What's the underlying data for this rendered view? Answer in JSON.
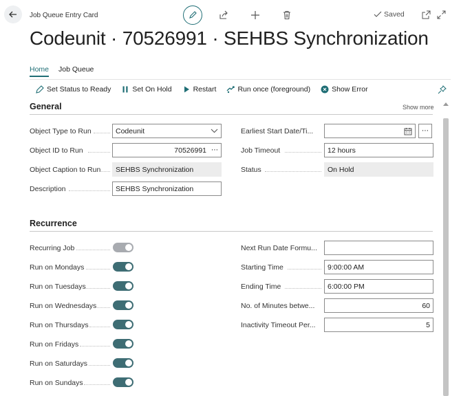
{
  "header": {
    "caption": "Job Queue Entry Card",
    "title": "Codeunit · 70526991 · SEHBS Synchronization",
    "saved_label": "Saved"
  },
  "tabs": [
    {
      "label": "Home",
      "active": true
    },
    {
      "label": "Job Queue",
      "active": false
    }
  ],
  "actions": [
    {
      "label": "Set Status to Ready",
      "icon": "set-status-icon"
    },
    {
      "label": "Set On Hold",
      "icon": "pause-icon"
    },
    {
      "label": "Restart",
      "icon": "play-icon"
    },
    {
      "label": "Run once (foreground)",
      "icon": "run-once-icon"
    },
    {
      "label": "Show Error",
      "icon": "error-icon"
    }
  ],
  "general": {
    "title": "General",
    "show_more": "Show more",
    "object_type": {
      "label": "Object Type to Run",
      "value": "Codeunit"
    },
    "object_id": {
      "label": "Object ID to Run",
      "value": "70526991"
    },
    "object_caption": {
      "label": "Object Caption to Run",
      "value": "SEHBS Synchronization"
    },
    "description": {
      "label": "Description",
      "value": "SEHBS Synchronization"
    },
    "earliest_start": {
      "label": "Earliest Start Date/Ti...",
      "value": ""
    },
    "job_timeout": {
      "label": "Job Timeout",
      "value": "12 hours"
    },
    "status": {
      "label": "Status",
      "value": "On Hold"
    }
  },
  "recurrence": {
    "title": "Recurrence",
    "toggles": [
      {
        "label": "Recurring Job",
        "on": true,
        "enabled": false
      },
      {
        "label": "Run on Mondays",
        "on": true,
        "enabled": true
      },
      {
        "label": "Run on Tuesdays",
        "on": true,
        "enabled": true
      },
      {
        "label": "Run on Wednesdays",
        "on": true,
        "enabled": true
      },
      {
        "label": "Run on Thursdays",
        "on": true,
        "enabled": true
      },
      {
        "label": "Run on Fridays",
        "on": true,
        "enabled": true
      },
      {
        "label": "Run on Saturdays",
        "on": true,
        "enabled": true
      },
      {
        "label": "Run on Sundays",
        "on": true,
        "enabled": true
      }
    ],
    "next_run_formula": {
      "label": "Next Run Date Formu...",
      "value": ""
    },
    "starting_time": {
      "label": "Starting Time",
      "value": "9:00:00 AM"
    },
    "ending_time": {
      "label": "Ending Time",
      "value": "6:00:00 PM"
    },
    "minutes_between": {
      "label": "No. of Minutes betwe...",
      "value": "60"
    },
    "inactivity_timeout": {
      "label": "Inactivity Timeout Per...",
      "value": "5"
    }
  },
  "colors": {
    "accent": "#1f6e75",
    "toggle_on": "#3e6d74",
    "toggle_disabled": "#a8abb0"
  }
}
